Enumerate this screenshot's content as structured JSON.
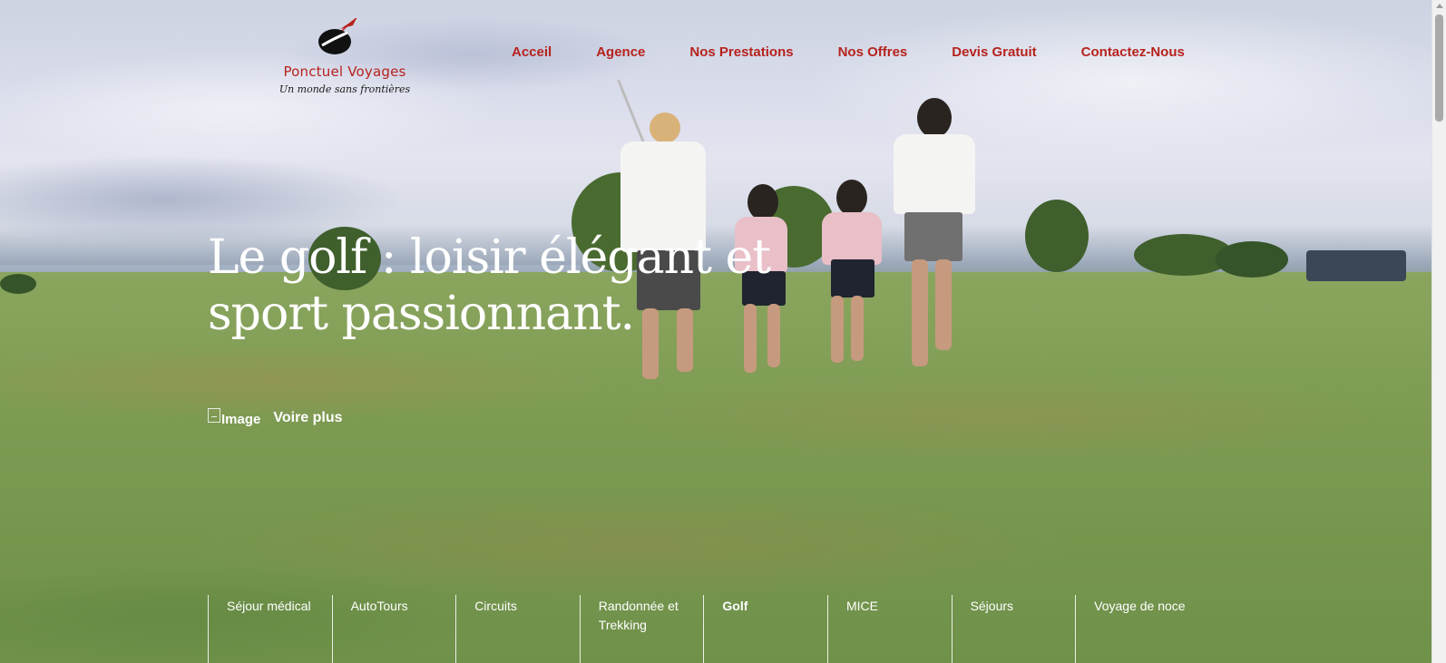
{
  "brand": {
    "name": "Ponctuel Voyages",
    "tagline": "Un monde sans frontières",
    "colors": {
      "primary": "#b7221d",
      "text_light": "#ffffff"
    }
  },
  "nav": {
    "items": [
      {
        "label": "Acceil"
      },
      {
        "label": "Agence"
      },
      {
        "label": "Nos Prestations"
      },
      {
        "label": "Nos Offres"
      },
      {
        "label": "Devis Gratuit"
      },
      {
        "label": "Contactez-Nous"
      }
    ]
  },
  "hero": {
    "headline_line1": "Le golf : loisir élégant et",
    "headline_line2": "sport passionnant.",
    "image_alt": "Image",
    "cta_label": "Voire plus"
  },
  "categories": {
    "active": "Golf",
    "items": [
      {
        "label": "Séjour médical"
      },
      {
        "label": "AutoTours"
      },
      {
        "label": "Circuits"
      },
      {
        "label": "Randonnée et Trekking"
      },
      {
        "label": "Golf"
      },
      {
        "label": "MICE"
      },
      {
        "label": "Séjours"
      },
      {
        "label": "Voyage de noce"
      }
    ]
  },
  "icons": {
    "logo": "plane-globe-logo-icon",
    "broken_image": "broken-image-icon",
    "scroll_up": "chevron-up-icon"
  }
}
